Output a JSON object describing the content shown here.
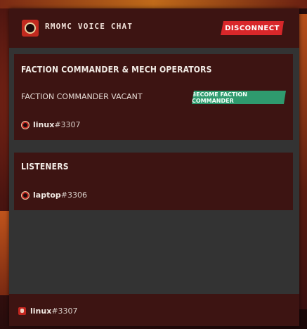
{
  "header": {
    "title": "RMOMC VOICE CHAT",
    "disconnect_label": "DISCONNECT"
  },
  "commander_section": {
    "title": "FACTION COMMANDER & MECH OPERATORS",
    "vacant_text": "FACTION COMMANDER VACANT",
    "become_label": "BECOME FACTION COMMANDER",
    "members": [
      {
        "name": "linux",
        "tag": "#3307"
      }
    ]
  },
  "listeners_section": {
    "title": "LISTENERS",
    "members": [
      {
        "name": "laptop",
        "tag": "#3306"
      }
    ]
  },
  "footer": {
    "name": "linux",
    "tag": "#3307"
  },
  "colors": {
    "panel_bg": "#333333",
    "section_bg": "#3d1412",
    "disconnect": "#d8272a",
    "become": "#2f9a6e"
  }
}
